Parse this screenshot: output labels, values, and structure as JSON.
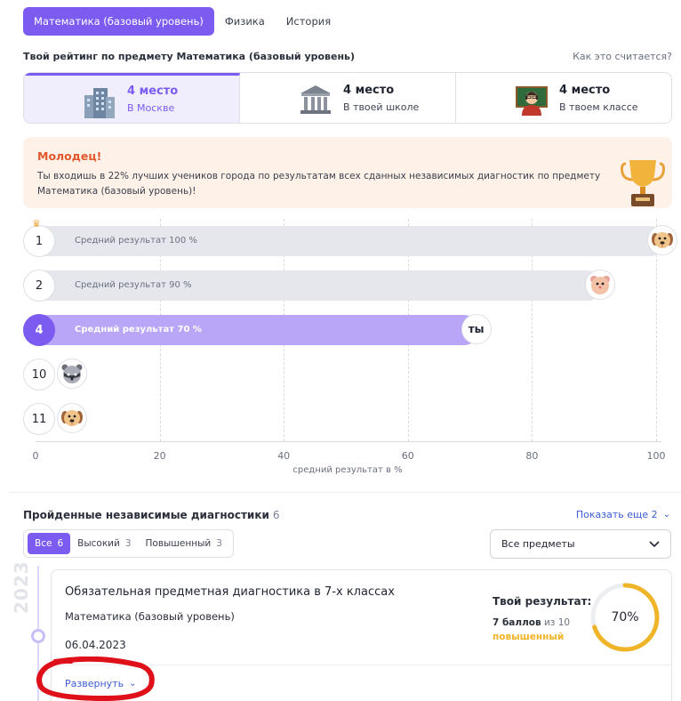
{
  "subject_tabs": [
    "Математика (базовый уровень)",
    "Физика",
    "История"
  ],
  "rating": {
    "title": "Твой рейтинг по предмету Математика (базовый уровень)",
    "how_link": "Как это считается?",
    "cards": [
      {
        "place": "4 место",
        "scope": "В Москве",
        "icon": "city-buildings-icon"
      },
      {
        "place": "4 место",
        "scope": "В твоей школе",
        "icon": "school-building-icon"
      },
      {
        "place": "4 место",
        "scope": "В твоем классе",
        "icon": "teacher-icon"
      }
    ]
  },
  "congrats": {
    "title": "Молодец!",
    "text": "Ты входишь в 22% лучших учеников города по результатам всех сданных независимых диагностик по предмету Математика (базовый уровень)!",
    "icon": "trophy-icon"
  },
  "chart_data": {
    "type": "bar",
    "orientation": "horizontal",
    "xlabel": "средний результат в %",
    "xlim": [
      0,
      100
    ],
    "xticks": [
      "0",
      "20",
      "40",
      "60",
      "80",
      "100"
    ],
    "grid": true,
    "bars": [
      {
        "rank": "1",
        "label": "Средний результат 100 %",
        "value": 100,
        "avatar": "dog-avatar-icon",
        "crown": true
      },
      {
        "rank": "2",
        "label": "Средний результат 90 %",
        "value": 90,
        "avatar": "hamster-avatar-icon"
      },
      {
        "rank": "4",
        "label": "Средний результат 70 %",
        "value": 70,
        "avatar_text": "ты",
        "is_me": true
      },
      {
        "rank": "10",
        "label": "",
        "value": 0,
        "avatar": "raccoon-avatar-icon"
      },
      {
        "rank": "11",
        "label": "",
        "value": 0,
        "avatar": "dog-avatar-icon"
      }
    ]
  },
  "diagnostics": {
    "title": "Пройденные независимые диагностики",
    "count": "6",
    "show_more": "Показать еще 2",
    "filters": [
      {
        "label": "Все",
        "count": "6"
      },
      {
        "label": "Высокий",
        "count": "3"
      },
      {
        "label": "Повышенный",
        "count": "3"
      }
    ],
    "subject_select": "Все предметы",
    "year": "2023",
    "card": {
      "name": "Обязательная предметная диагностика в 7-х классах",
      "subject": "Математика (базовый уровень)",
      "date": "06.04.2023",
      "result_label": "Твой результат:",
      "score": "7 баллов",
      "score_of": "из 10",
      "level": "повышенный",
      "percent": "70%",
      "percent_value": 0.7,
      "expand": "Развернуть"
    }
  },
  "colors": {
    "accent": "#7c5cf0",
    "bar_me": "#b9a6f6",
    "bar_other": "#e6e7ec",
    "congrats_bg": "#fdf1e8",
    "congrats_title": "#e2572c",
    "level": "#f0b429",
    "link": "#3b5bd4",
    "annotation": "#e0101a"
  }
}
